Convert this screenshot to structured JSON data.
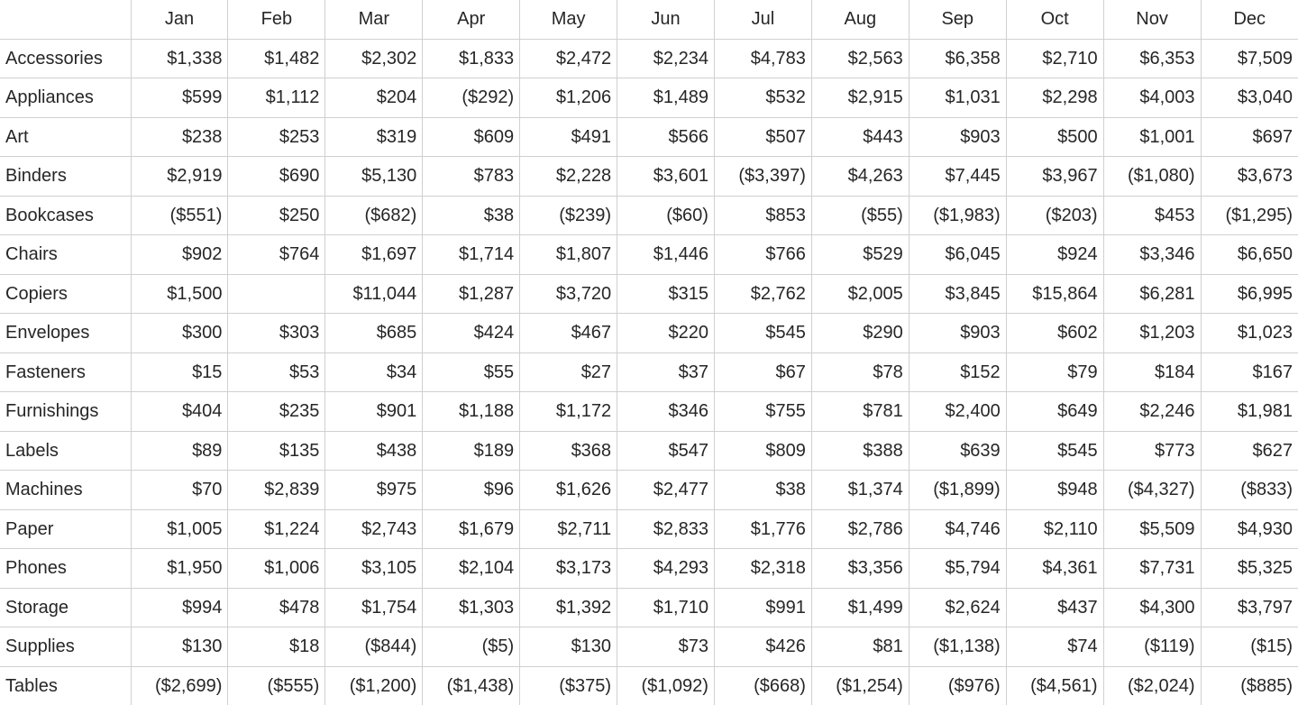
{
  "table": {
    "corner_label": "",
    "columns": [
      "Jan",
      "Feb",
      "Mar",
      "Apr",
      "May",
      "Jun",
      "Jul",
      "Aug",
      "Sep",
      "Oct",
      "Nov",
      "Dec"
    ],
    "row_labels": [
      "Accessories",
      "Appliances",
      "Art",
      "Binders",
      "Bookcases",
      "Chairs",
      "Copiers",
      "Envelopes",
      "Fasteners",
      "Furnishings",
      "Labels",
      "Machines",
      "Paper",
      "Phones",
      "Storage",
      "Supplies",
      "Tables"
    ],
    "rows": [
      {
        "label": "Accessories",
        "cells": [
          "$1,338",
          "$1,482",
          "$2,302",
          "$1,833",
          "$2,472",
          "$2,234",
          "$4,783",
          "$2,563",
          "$6,358",
          "$2,710",
          "$6,353",
          "$7,509"
        ]
      },
      {
        "label": "Appliances",
        "cells": [
          "$599",
          "$1,112",
          "$204",
          "($292)",
          "$1,206",
          "$1,489",
          "$532",
          "$2,915",
          "$1,031",
          "$2,298",
          "$4,003",
          "$3,040"
        ]
      },
      {
        "label": "Art",
        "cells": [
          "$238",
          "$253",
          "$319",
          "$609",
          "$491",
          "$566",
          "$507",
          "$443",
          "$903",
          "$500",
          "$1,001",
          "$697"
        ]
      },
      {
        "label": "Binders",
        "cells": [
          "$2,919",
          "$690",
          "$5,130",
          "$783",
          "$2,228",
          "$3,601",
          "($3,397)",
          "$4,263",
          "$7,445",
          "$3,967",
          "($1,080)",
          "$3,673"
        ]
      },
      {
        "label": "Bookcases",
        "cells": [
          "($551)",
          "$250",
          "($682)",
          "$38",
          "($239)",
          "($60)",
          "$853",
          "($55)",
          "($1,983)",
          "($203)",
          "$453",
          "($1,295)"
        ]
      },
      {
        "label": "Chairs",
        "cells": [
          "$902",
          "$764",
          "$1,697",
          "$1,714",
          "$1,807",
          "$1,446",
          "$766",
          "$529",
          "$6,045",
          "$924",
          "$3,346",
          "$6,650"
        ]
      },
      {
        "label": "Copiers",
        "cells": [
          "$1,500",
          "",
          "$11,044",
          "$1,287",
          "$3,720",
          "$315",
          "$2,762",
          "$2,005",
          "$3,845",
          "$15,864",
          "$6,281",
          "$6,995"
        ]
      },
      {
        "label": "Envelopes",
        "cells": [
          "$300",
          "$303",
          "$685",
          "$424",
          "$467",
          "$220",
          "$545",
          "$290",
          "$903",
          "$602",
          "$1,203",
          "$1,023"
        ]
      },
      {
        "label": "Fasteners",
        "cells": [
          "$15",
          "$53",
          "$34",
          "$55",
          "$27",
          "$37",
          "$67",
          "$78",
          "$152",
          "$79",
          "$184",
          "$167"
        ]
      },
      {
        "label": "Furnishings",
        "cells": [
          "$404",
          "$235",
          "$901",
          "$1,188",
          "$1,172",
          "$346",
          "$755",
          "$781",
          "$2,400",
          "$649",
          "$2,246",
          "$1,981"
        ]
      },
      {
        "label": "Labels",
        "cells": [
          "$89",
          "$135",
          "$438",
          "$189",
          "$368",
          "$547",
          "$809",
          "$388",
          "$639",
          "$545",
          "$773",
          "$627"
        ]
      },
      {
        "label": "Machines",
        "cells": [
          "$70",
          "$2,839",
          "$975",
          "$96",
          "$1,626",
          "$2,477",
          "$38",
          "$1,374",
          "($1,899)",
          "$948",
          "($4,327)",
          "($833)"
        ]
      },
      {
        "label": "Paper",
        "cells": [
          "$1,005",
          "$1,224",
          "$2,743",
          "$1,679",
          "$2,711",
          "$2,833",
          "$1,776",
          "$2,786",
          "$4,746",
          "$2,110",
          "$5,509",
          "$4,930"
        ]
      },
      {
        "label": "Phones",
        "cells": [
          "$1,950",
          "$1,006",
          "$3,105",
          "$2,104",
          "$3,173",
          "$4,293",
          "$2,318",
          "$3,356",
          "$5,794",
          "$4,361",
          "$7,731",
          "$5,325"
        ]
      },
      {
        "label": "Storage",
        "cells": [
          "$994",
          "$478",
          "$1,754",
          "$1,303",
          "$1,392",
          "$1,710",
          "$991",
          "$1,499",
          "$2,624",
          "$437",
          "$4,300",
          "$3,797"
        ]
      },
      {
        "label": "Supplies",
        "cells": [
          "$130",
          "$18",
          "($844)",
          "($5)",
          "$130",
          "$73",
          "$426",
          "$81",
          "($1,138)",
          "$74",
          "($119)",
          "($15)"
        ]
      },
      {
        "label": "Tables",
        "cells": [
          "($2,699)",
          "($555)",
          "($1,200)",
          "($1,438)",
          "($375)",
          "($1,092)",
          "($668)",
          "($1,254)",
          "($976)",
          "($4,561)",
          "($2,024)",
          "($885)"
        ]
      }
    ]
  },
  "chart_data": {
    "type": "table",
    "title": "",
    "xlabel": "",
    "ylabel": "",
    "categories": [
      "Jan",
      "Feb",
      "Mar",
      "Apr",
      "May",
      "Jun",
      "Jul",
      "Aug",
      "Sep",
      "Oct",
      "Nov",
      "Dec"
    ],
    "series": [
      {
        "name": "Accessories",
        "values": [
          1338,
          1482,
          2302,
          1833,
          2472,
          2234,
          4783,
          2563,
          6358,
          2710,
          6353,
          7509
        ]
      },
      {
        "name": "Appliances",
        "values": [
          599,
          1112,
          204,
          -292,
          1206,
          1489,
          532,
          2915,
          1031,
          2298,
          4003,
          3040
        ]
      },
      {
        "name": "Art",
        "values": [
          238,
          253,
          319,
          609,
          491,
          566,
          507,
          443,
          903,
          500,
          1001,
          697
        ]
      },
      {
        "name": "Binders",
        "values": [
          2919,
          690,
          5130,
          783,
          2228,
          3601,
          -3397,
          4263,
          7445,
          3967,
          -1080,
          3673
        ]
      },
      {
        "name": "Bookcases",
        "values": [
          -551,
          250,
          -682,
          38,
          -239,
          -60,
          853,
          -55,
          -1983,
          -203,
          453,
          -1295
        ]
      },
      {
        "name": "Chairs",
        "values": [
          902,
          764,
          1697,
          1714,
          1807,
          1446,
          766,
          529,
          6045,
          924,
          3346,
          6650
        ]
      },
      {
        "name": "Copiers",
        "values": [
          1500,
          null,
          11044,
          1287,
          3720,
          315,
          2762,
          2005,
          3845,
          15864,
          6281,
          6995
        ]
      },
      {
        "name": "Envelopes",
        "values": [
          300,
          303,
          685,
          424,
          467,
          220,
          545,
          290,
          903,
          602,
          1203,
          1023
        ]
      },
      {
        "name": "Fasteners",
        "values": [
          15,
          53,
          34,
          55,
          27,
          37,
          67,
          78,
          152,
          79,
          184,
          167
        ]
      },
      {
        "name": "Furnishings",
        "values": [
          404,
          235,
          901,
          1188,
          1172,
          346,
          755,
          781,
          2400,
          649,
          2246,
          1981
        ]
      },
      {
        "name": "Labels",
        "values": [
          89,
          135,
          438,
          189,
          368,
          547,
          809,
          388,
          639,
          545,
          773,
          627
        ]
      },
      {
        "name": "Machines",
        "values": [
          70,
          2839,
          975,
          96,
          1626,
          2477,
          38,
          1374,
          -1899,
          948,
          -4327,
          -833
        ]
      },
      {
        "name": "Paper",
        "values": [
          1005,
          1224,
          2743,
          1679,
          2711,
          2833,
          1776,
          2786,
          4746,
          2110,
          5509,
          4930
        ]
      },
      {
        "name": "Phones",
        "values": [
          1950,
          1006,
          3105,
          2104,
          3173,
          4293,
          2318,
          3356,
          5794,
          4361,
          7731,
          5325
        ]
      },
      {
        "name": "Storage",
        "values": [
          994,
          478,
          1754,
          1303,
          1392,
          1710,
          991,
          1499,
          2624,
          437,
          4300,
          3797
        ]
      },
      {
        "name": "Supplies",
        "values": [
          130,
          18,
          -844,
          -5,
          130,
          73,
          426,
          81,
          -1138,
          74,
          -119,
          -15
        ]
      },
      {
        "name": "Tables",
        "values": [
          -2699,
          -555,
          -1200,
          -1438,
          -375,
          -1092,
          -668,
          -1254,
          -976,
          -4561,
          -2024,
          -885
        ]
      }
    ]
  },
  "style": {
    "grid_line_color": "#d0d0d0",
    "text_color": "#262626",
    "background": "#ffffff"
  }
}
